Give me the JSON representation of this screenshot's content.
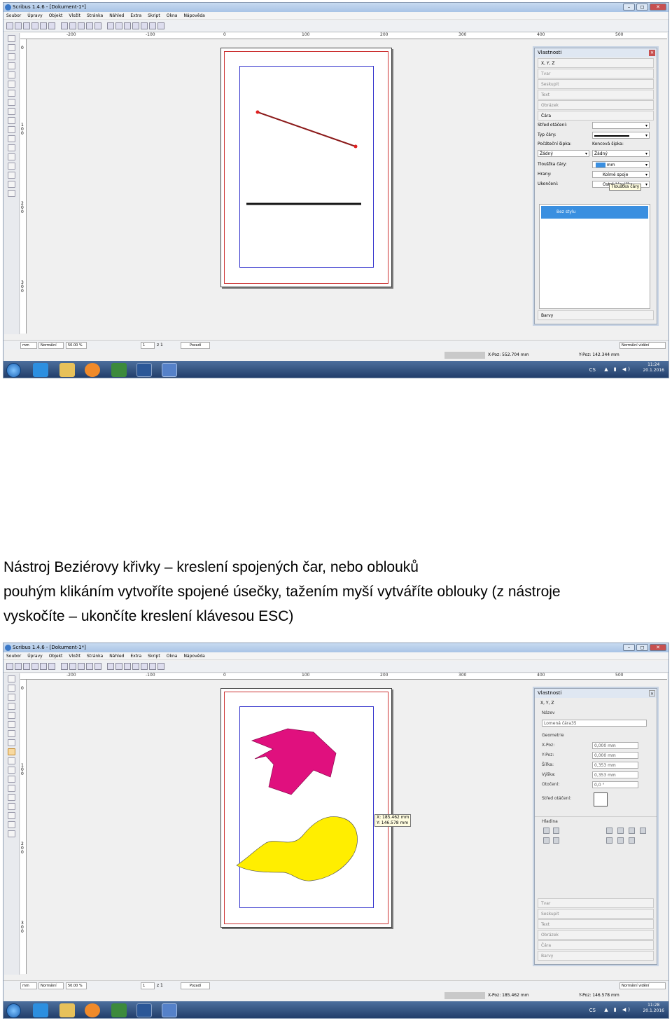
{
  "window": {
    "title": "Scribus 1.4.6 - [Dokument-1*]",
    "controls": [
      "–",
      "◻",
      "✕"
    ]
  },
  "menu": [
    "Soubor",
    "Úpravy",
    "Objekt",
    "Vložit",
    "Stránka",
    "Náhled",
    "Extra",
    "Skript",
    "Okna",
    "Nápověda"
  ],
  "ruler": {
    "h_ticks": [
      "-200",
      "-100",
      "0",
      "100",
      "200",
      "300",
      "400",
      "500"
    ],
    "v_ticks": [
      "0",
      "100",
      "200",
      "300"
    ]
  },
  "status": {
    "unit": "mm",
    "mode": "Normální",
    "zoom": "50.00 %",
    "page": "1",
    "page_of": "z 1",
    "layer": "Pozadí",
    "view": "Normální vidění"
  },
  "taskbar": {
    "lang": "CS"
  },
  "screenshot1": {
    "panel": {
      "title": "Vlastnosti",
      "section_xyz": "X, Y, Z",
      "section_shape": "Tvar",
      "section_group": "Seskupit",
      "section_text": "Text",
      "section_image": "Obrázek",
      "section_line": "Čára",
      "rotation_center_label": "Střed otáčení:",
      "line_type_label": "Typ čáry:",
      "start_arrow_label": "Počáteční šipka:",
      "end_arrow_label": "Koncová šipka:",
      "start_arrow_value": "Žádný",
      "end_arrow_value": "Žádný",
      "line_width_label": "Tloušťka čáry:",
      "line_width_value": "mm",
      "edges_label": "Hrany:",
      "edges_value": "Kolmé spoje",
      "ending_label": "Ukončení:",
      "ending_value": "Ostrá hlavička",
      "style_item": "Bez stylu",
      "section_colors": "Barvy",
      "tooltip": "Tloušťka čáry"
    },
    "coords": {
      "x": "X-Poz:  552.704 mm",
      "y": "Y-Poz:  142.344 mm"
    },
    "clock": {
      "time": "11:24",
      "date": "20.1.2016"
    }
  },
  "caption": {
    "line1": "Nástroj Beziérovy křivky – kreslení spojených čar, nebo oblouků",
    "line2": "pouhým klikáním vytvoříte spojené úsečky, tažením myší vytváříte oblouky (z nástroje",
    "line3": "vyskočíte – ukončíte kreslení klávesou ESC)"
  },
  "screenshot2": {
    "panel": {
      "title": "Vlastnosti",
      "section_xyz": "X, Y, Z",
      "name_label": "Název",
      "name_value": "Lomená čára35",
      "geometry_label": "Geometrie",
      "xpos_label": "X-Poz:",
      "xpos_value": "0,000 mm",
      "ypos_label": "Y-Poz:",
      "ypos_value": "0,000 mm",
      "width_label": "Šířka:",
      "width_value": "0,353 mm",
      "height_label": "Výška:",
      "height_value": "0,353 mm",
      "rotation_label": "Otočení:",
      "rotation_value": "0,0 °",
      "rotation_center_label": "Střed otáčení:",
      "level_label": "Hladina",
      "section_shape": "Tvar",
      "section_group": "Seskupit",
      "section_text": "Text",
      "section_image": "Obrázek",
      "section_line": "Čára",
      "section_colors": "Barvy"
    },
    "cursor_tooltip": {
      "x": "X: 185.462 mm",
      "y": "Y: 146.578 mm"
    },
    "coords": {
      "x": "X-Poz:  185.462 mm",
      "y": "Y-Poz:  146.578 mm"
    },
    "clock": {
      "time": "11:28",
      "date": "20.1.2016"
    }
  },
  "colors": {
    "magenta_shape": "#e0107e",
    "yellow_shape": "#ffee00",
    "bezier_line": "#8b1a1a",
    "selection_blue": "#3a8fe0"
  }
}
